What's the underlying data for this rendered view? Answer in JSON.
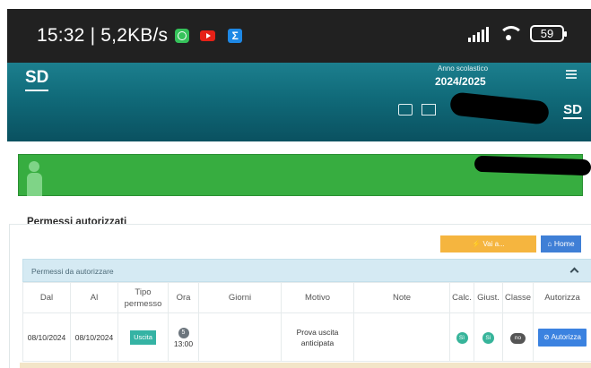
{
  "status_bar": {
    "time": "15:32 | 5,2KB/s",
    "notification_icons": [
      "whatsapp-icon",
      "youtube-icon",
      "sigma-icon"
    ],
    "battery": "59"
  },
  "header": {
    "logo": "SD",
    "school_year_label": "Anno scolastico",
    "school_year": "2024/2025",
    "user_initials": "SD"
  },
  "section": {
    "title": "Permessi autorizzati",
    "vai_button": "Vai a...",
    "home_button": "Home",
    "accordion_label": "Permessi da autorizzare"
  },
  "table": {
    "headers": {
      "dal": "Dal",
      "al": "Al",
      "tipo": "Tipo permesso",
      "ora": "Ora",
      "giorni": "Giorni",
      "motivo": "Motivo",
      "note": "Note",
      "calc": "Calc.",
      "giust": "Giust.",
      "classe": "Classe",
      "autorizza": "Autorizza"
    },
    "rows": [
      {
        "dal": "08/10/2024",
        "al": "08/10/2024",
        "tipo": "Uscita",
        "ora_num": "5",
        "ora_time": "13:00",
        "giorni": "",
        "motivo": "Prova uscita anticipata",
        "note": "",
        "calc": "Sì",
        "giust": "Sì",
        "classe": "no",
        "autorizza": "Autorizza"
      }
    ]
  },
  "colors": {
    "header_teal": "#106a79",
    "banner_green": "#37ad40",
    "accordion_bg": "#d5eaf3",
    "vai_orange": "#f5b53f",
    "primary_blue": "#3b82e0",
    "badge_teal": "#35b3a4"
  }
}
